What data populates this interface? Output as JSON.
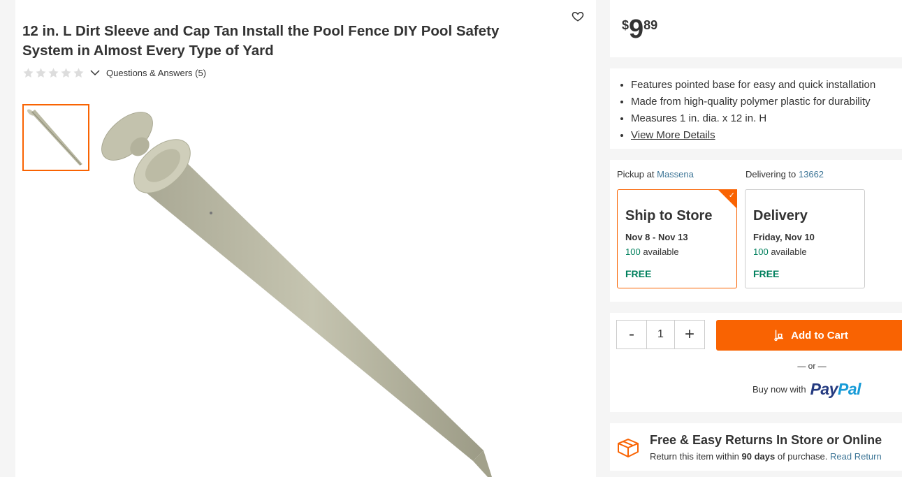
{
  "product": {
    "title": "12 in. L Dirt Sleeve and Cap Tan Install the Pool Fence DIY Pool Safety System in Almost Every Type of Yard",
    "rating_stars": 0,
    "rating_max": 5,
    "questions_answers": "Questions & Answers (5)"
  },
  "price": {
    "currency": "$",
    "dollars": "9",
    "cents": "89"
  },
  "features": [
    "Features pointed base for easy and quick installation",
    "Made from high-quality polymer plastic for durability",
    "Measures 1 in. dia. x 12 in. H"
  ],
  "features_link": "View More Details",
  "fulfillment": {
    "pickup_label": "Pickup at",
    "pickup_store": "Massena",
    "delivery_label": "Delivering to",
    "delivery_zip": "13662",
    "options": [
      {
        "title": "Ship to Store",
        "date": "Nov 8 - Nov 13",
        "available_count": "100",
        "available_text": "available",
        "price": "FREE",
        "selected": true
      },
      {
        "title": "Delivery",
        "date": "Friday, Nov 10",
        "available_count": "100",
        "available_text": "available",
        "price": "FREE",
        "selected": false
      }
    ]
  },
  "cart": {
    "minus": "-",
    "quantity": "1",
    "plus": "+",
    "add_label": "Add to Cart",
    "or_text": "— or —",
    "buy_now": "Buy now with",
    "paypal_part1": "Pay",
    "paypal_part2": "Pal"
  },
  "returns": {
    "title": "Free & Easy Returns In Store or Online",
    "sub_prefix": "Return this item within",
    "sub_days": "90 days",
    "sub_suffix": "of purchase.",
    "link": "Read Return"
  },
  "colors": {
    "brand_orange": "#f96302",
    "green": "#00805d",
    "link_blue": "#3e7697",
    "paypal_dark": "#253b80",
    "paypal_light": "#179bd7"
  },
  "icons": [
    "heart-outline-icon",
    "star-empty-icon",
    "chevron-down-icon",
    "checkmark-icon",
    "cart-dolly-icon",
    "returns-box-icon"
  ]
}
